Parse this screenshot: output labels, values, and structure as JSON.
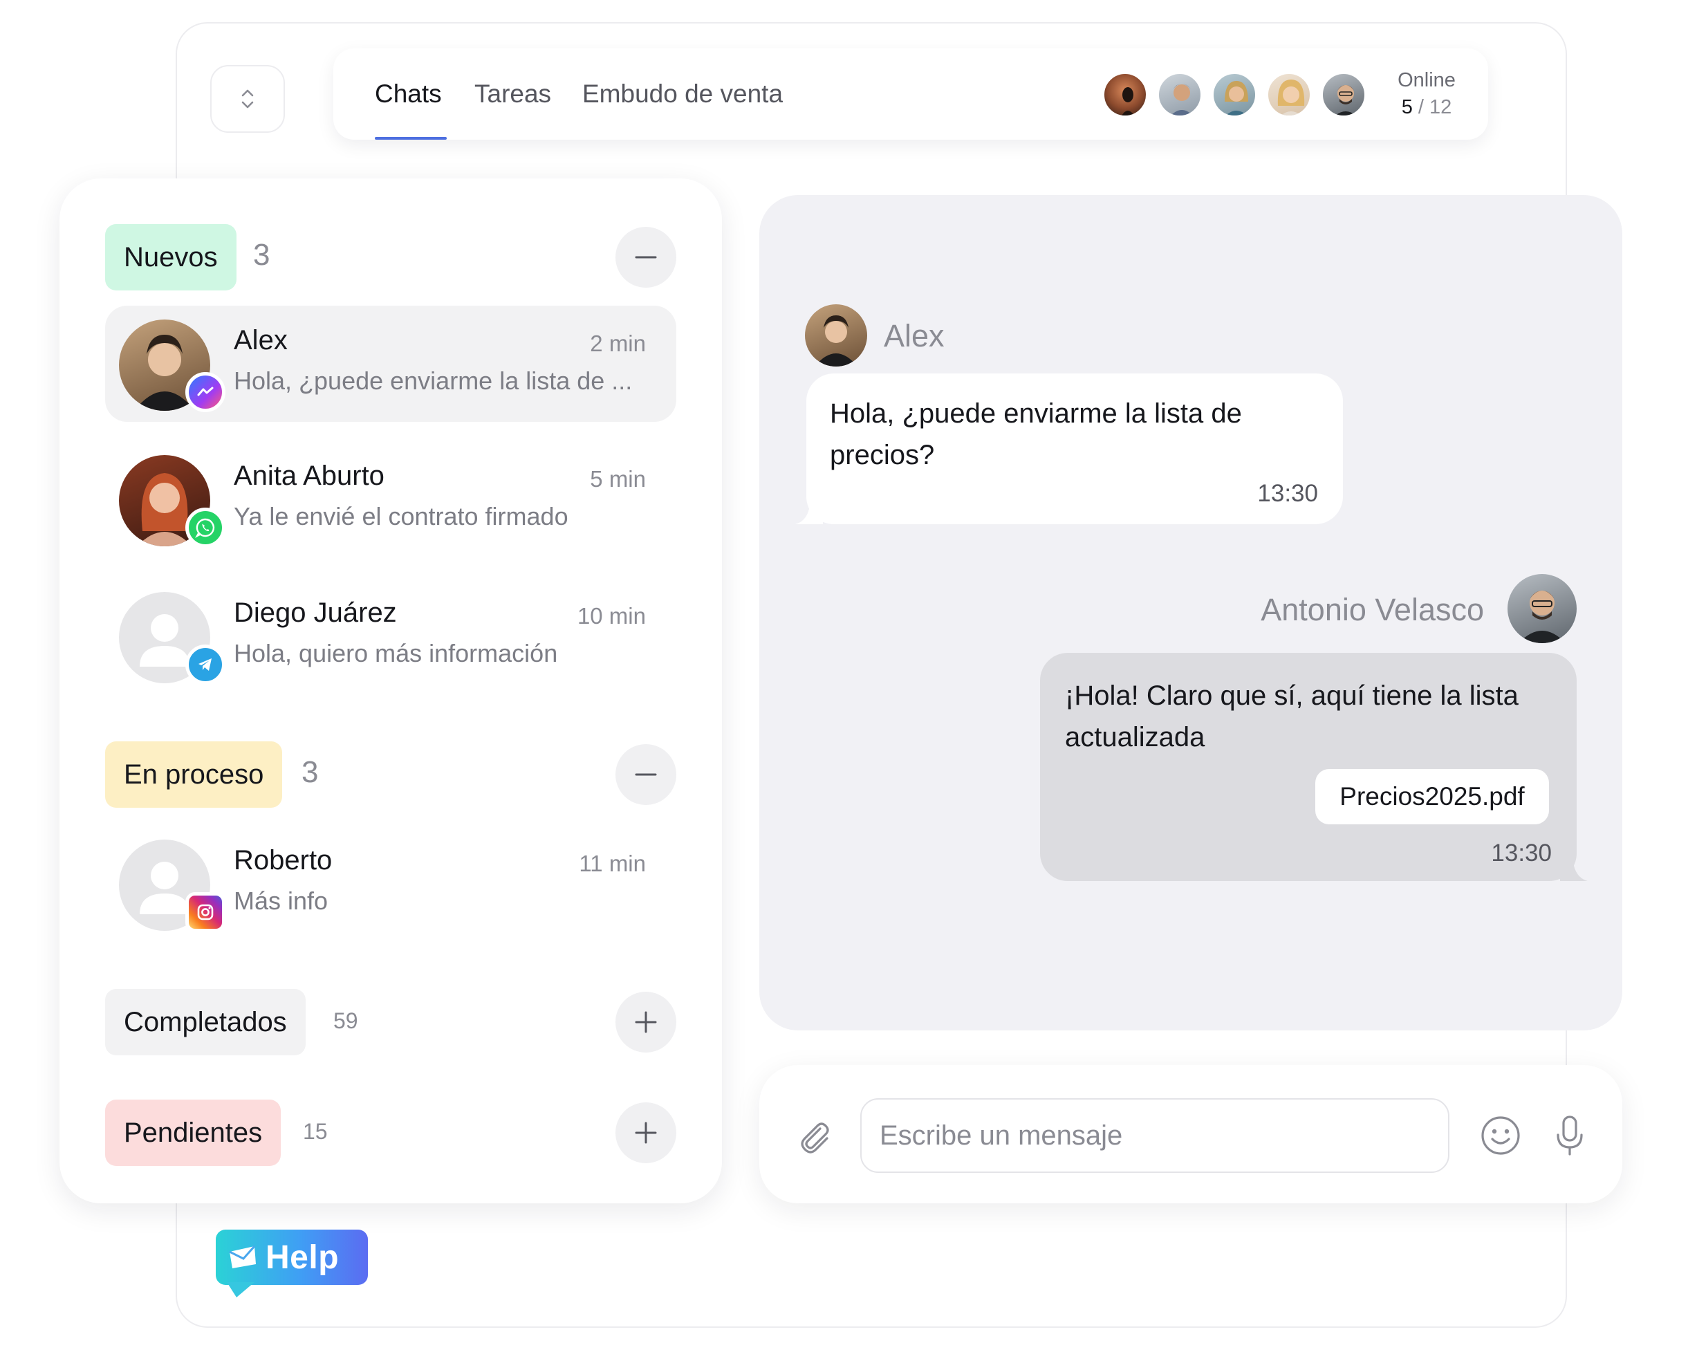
{
  "topbar": {
    "tabs": [
      {
        "label": "Chats",
        "active": true
      },
      {
        "label": "Tareas",
        "active": false
      },
      {
        "label": "Embudo de venta",
        "active": false
      }
    ],
    "online_label": "Online",
    "online_current": "5",
    "online_total": "12",
    "accent_color": "#4d6fe0"
  },
  "chat_groups": [
    {
      "label": "Nuevos",
      "count": "3",
      "color": "#cff7e3",
      "expanded": true,
      "chats": [
        {
          "name": "Alex",
          "time": "2 min",
          "preview": "Hola, ¿puede enviarme la lista de ...",
          "channel": "messenger",
          "selected": true
        },
        {
          "name": "Anita Aburto",
          "time": "5 min",
          "preview": "Ya le envié el contrato firmado",
          "channel": "whatsapp",
          "selected": false
        },
        {
          "name": "Diego Juárez",
          "time": "10 min",
          "preview": "Hola, quiero más información",
          "channel": "telegram",
          "selected": false
        }
      ]
    },
    {
      "label": "En proceso",
      "count": "3",
      "color": "#fdefc4",
      "expanded": true,
      "chats": [
        {
          "name": "Roberto",
          "time": "11 min",
          "preview": "Más info",
          "channel": "instagram",
          "selected": false
        }
      ]
    },
    {
      "label": "Completados",
      "count": "59",
      "color": "#f2f2f3",
      "expanded": false
    },
    {
      "label": "Pendientes",
      "count": "15",
      "color": "#fcdcdc",
      "expanded": false
    }
  ],
  "conversation": {
    "incoming": {
      "sender": "Alex",
      "text": "Hola, ¿puede enviarme la lista de precios?",
      "time": "13:30"
    },
    "outgoing": {
      "sender": "Antonio Velasco",
      "text": "¡Hola! Claro que sí, aquí tiene la lista actualizada",
      "attachment": "Precios2025.pdf",
      "time": "13:30"
    }
  },
  "composer": {
    "placeholder": "Escribe un mensaje",
    "icons": [
      "paperclip-icon",
      "emoji-icon",
      "microphone-icon"
    ]
  },
  "brand": {
    "logo_text": "Help"
  }
}
